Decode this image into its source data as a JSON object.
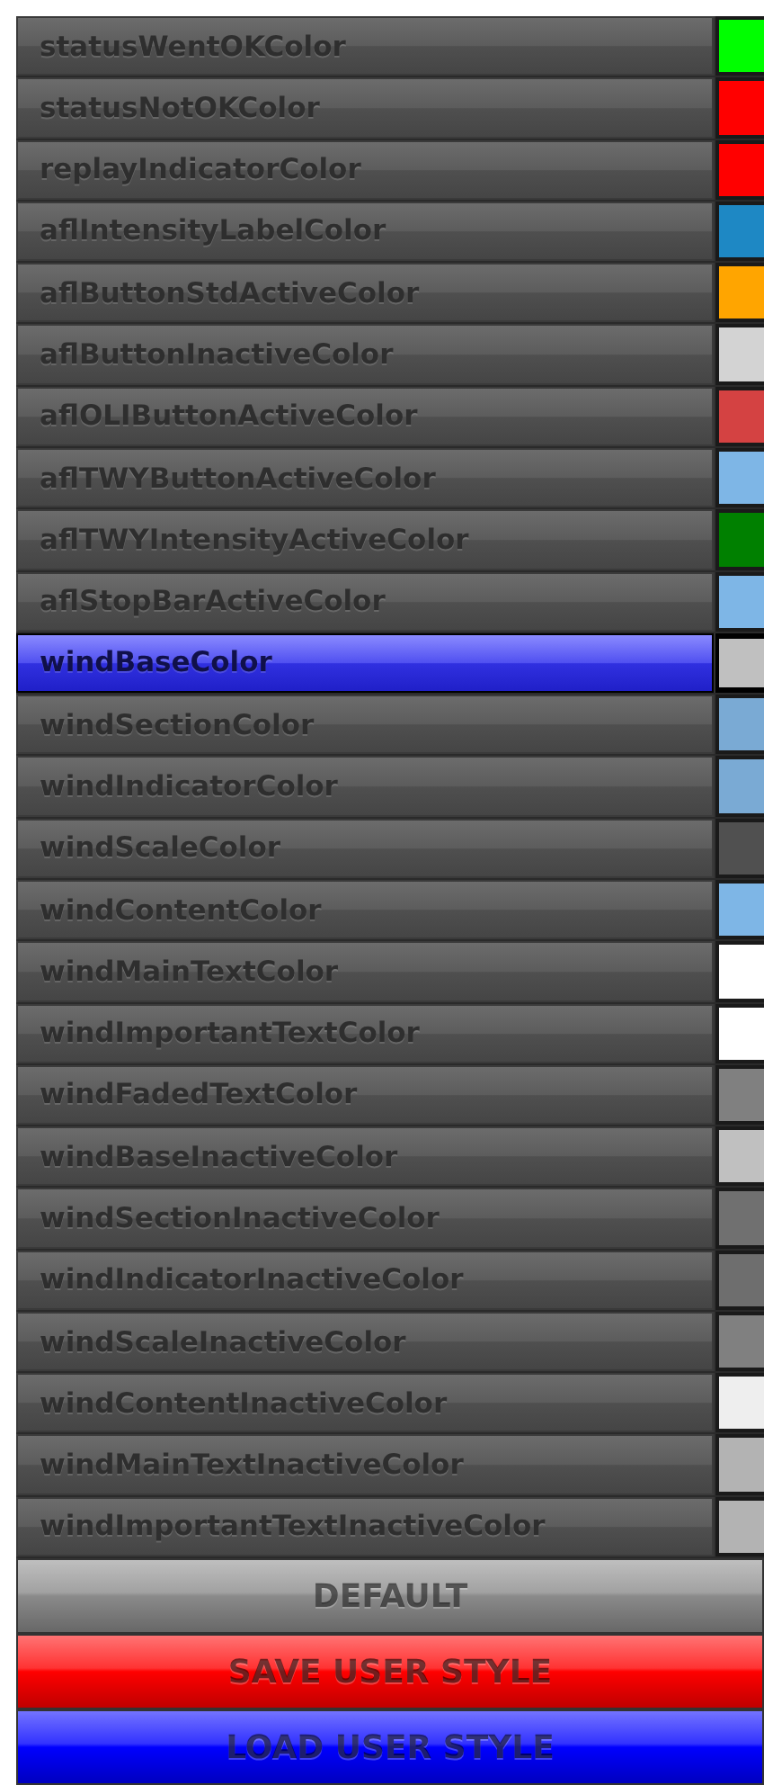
{
  "color_settings": [
    {
      "name": "statusWentOKColor",
      "color": "#00ff00",
      "selected": false
    },
    {
      "name": "statusNotOKColor",
      "color": "#ff0000",
      "selected": false
    },
    {
      "name": "replayIndicatorColor",
      "color": "#ff0000",
      "selected": false
    },
    {
      "name": "aflIntensityLabelColor",
      "color": "#1e88c4",
      "selected": false
    },
    {
      "name": "aflButtonStdActiveColor",
      "color": "#ffa500",
      "selected": false
    },
    {
      "name": "aflButtonInactiveColor",
      "color": "#d3d3d3",
      "selected": false
    },
    {
      "name": "aflOLIButtonActiveColor",
      "color": "#d44242",
      "selected": false
    },
    {
      "name": "aflTWYButtonActiveColor",
      "color": "#7eb6e6",
      "selected": false
    },
    {
      "name": "aflTWYIntensityActiveColor",
      "color": "#008000",
      "selected": false
    },
    {
      "name": "aflStopBarActiveColor",
      "color": "#7eb6e6",
      "selected": false
    },
    {
      "name": "windBaseColor",
      "color": "#c0c0c0",
      "selected": true
    },
    {
      "name": "windSectionColor",
      "color": "#7aaad4",
      "selected": false
    },
    {
      "name": "windIndicatorColor",
      "color": "#7aaad4",
      "selected": false
    },
    {
      "name": "windScaleColor",
      "color": "#505050",
      "selected": false
    },
    {
      "name": "windContentColor",
      "color": "#7eb6e6",
      "selected": false
    },
    {
      "name": "windMainTextColor",
      "color": "#ffffff",
      "selected": false
    },
    {
      "name": "windImportantTextColor",
      "color": "#ffffff",
      "selected": false
    },
    {
      "name": "windFadedTextColor",
      "color": "#808080",
      "selected": false
    },
    {
      "name": "windBaseInactiveColor",
      "color": "#c0c0c0",
      "selected": false
    },
    {
      "name": "windSectionInactiveColor",
      "color": "#707070",
      "selected": false
    },
    {
      "name": "windIndicatorInactiveColor",
      "color": "#6e6e6e",
      "selected": false
    },
    {
      "name": "windScaleInactiveColor",
      "color": "#808080",
      "selected": false
    },
    {
      "name": "windContentInactiveColor",
      "color": "#eeeeee",
      "selected": false
    },
    {
      "name": "windMainTextInactiveColor",
      "color": "#b3b3b3",
      "selected": false
    },
    {
      "name": "windImportantTextInactiveColor",
      "color": "#b3b3b3",
      "selected": false
    }
  ],
  "buttons": [
    {
      "label": "DEFAULT",
      "color": "#8a8a8a"
    },
    {
      "label": "SAVE USER STYLE",
      "color": "#ff0000"
    },
    {
      "label": "LOAD USER STYLE",
      "color": "#0000ff"
    }
  ]
}
